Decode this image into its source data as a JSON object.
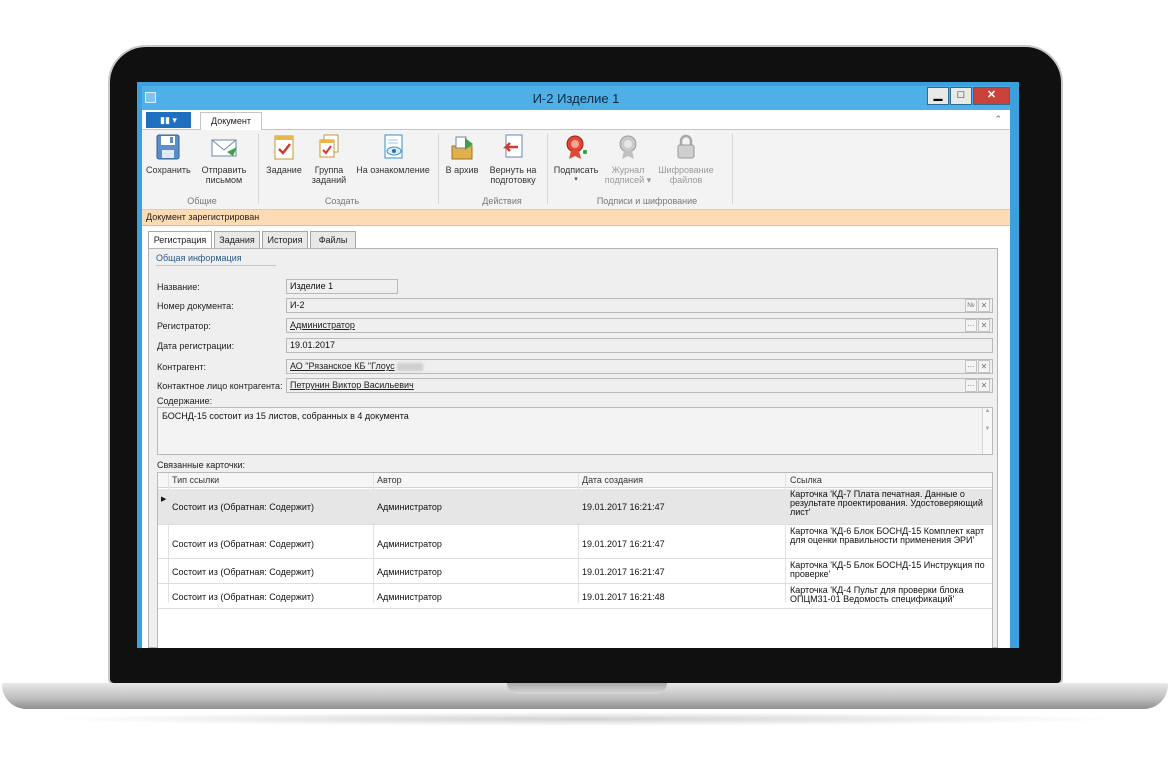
{
  "window": {
    "title": "И-2 Изделие 1"
  },
  "ribbon": {
    "file_tab": "▮▮ ▾",
    "doc_tab": "Документ",
    "buttons": {
      "save": "Сохранить",
      "send1": "Отправить",
      "send2": "письмом",
      "task": "Задание",
      "group1": "Группа",
      "group2": "заданий",
      "review": "На ознакомление",
      "archive": "В архив",
      "return1": "Вернуть на",
      "return2": "подготовку",
      "sign": "Подписать",
      "journal1": "Журнал",
      "journal2": "подписей ▾",
      "encrypt1": "Шифрование",
      "encrypt2": "файлов"
    },
    "groups": {
      "general": "Общие",
      "create": "Создать",
      "actions": "Действия",
      "signatures": "Подписи и шифрование"
    }
  },
  "status_text": "Документ зарегистрирован",
  "tabs": [
    "Регистрация",
    "Задания",
    "История",
    "Файлы"
  ],
  "section_title": "Общая информация",
  "form": {
    "name_label": "Название:",
    "name_value": "Изделие 1",
    "number_label": "Номер документа:",
    "number_value": "И-2",
    "number_btn": "№",
    "registrar_label": "Регистратор:",
    "registrar_value": "Администратор",
    "date_label": "Дата регистрации:",
    "date_value": "19.01.2017",
    "contractor_label": "Контрагент:",
    "contractor_value": "АО \"Рязанское КБ \"Глоус",
    "contact_label": "Контактное лицо контрагента:",
    "contact_value": "Петрунин Виктор Васильевич",
    "content_label": "Содержание:",
    "content_value": "БОСНД-15 состоит из 15 листов, собранных в 4 документа",
    "linked_label": "Связанные карточки:"
  },
  "grid": {
    "headers": [
      "Тип ссылки",
      "Автор",
      "Дата создания",
      "Ссылка"
    ],
    "rows": [
      [
        "Состоит из (Обратная: Содержит)",
        "Администратор",
        "19.01.2017 16:21:47",
        "Карточка 'КД-7 Плата печатная. Данные о результате проектирования. Удостоверяющий лист'"
      ],
      [
        "Состоит из (Обратная: Содержит)",
        "Администратор",
        "19.01.2017 16:21:47",
        "Карточка 'КД-6 Блок БОСНД-15 Комплект карт для оценки правильности применения ЭРИ'"
      ],
      [
        "Состоит из (Обратная: Содержит)",
        "Администратор",
        "19.01.2017 16:21:47",
        "Карточка 'КД-5 Блок БОСНД-15 Инструкция по проверке'"
      ],
      [
        "Состоит из (Обратная: Содержит)",
        "Администратор",
        "19.01.2017 16:21:48",
        "Карточка 'КД-4 Пульт для проверки блока ОПЦМ31-01 Ведомость спецификаций'"
      ]
    ]
  },
  "colors": {
    "title_bar": "#4fb0e8",
    "status_bar": "#fcdbb5",
    "file_button": "#1f6fbf",
    "close_button": "#c9413b"
  }
}
